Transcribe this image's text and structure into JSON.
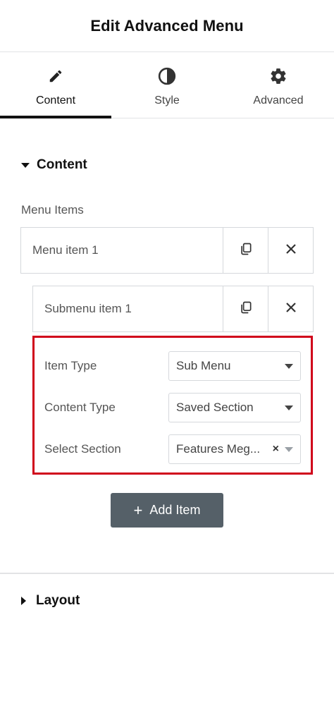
{
  "header": {
    "title": "Edit Advanced Menu"
  },
  "tabs": [
    {
      "label": "Content",
      "icon": "pencil-icon",
      "active": true
    },
    {
      "label": "Style",
      "icon": "contrast-icon",
      "active": false
    },
    {
      "label": "Advanced",
      "icon": "gear-icon",
      "active": false
    }
  ],
  "content_section": {
    "title": "Content",
    "menu_items_label": "Menu Items",
    "menu_item": {
      "title": "Menu item 1"
    },
    "submenu_item": {
      "title": "Submenu item 1"
    },
    "controls": {
      "item_type": {
        "label": "Item Type",
        "value": "Sub Menu"
      },
      "content_type": {
        "label": "Content Type",
        "value": "Saved Section"
      },
      "select_section": {
        "label": "Select Section",
        "value": "Features Meg..."
      }
    },
    "add_item_label": "Add Item"
  },
  "layout_section": {
    "title": "Layout"
  },
  "colors": {
    "highlight": "#d0021b",
    "button": "#556068"
  }
}
